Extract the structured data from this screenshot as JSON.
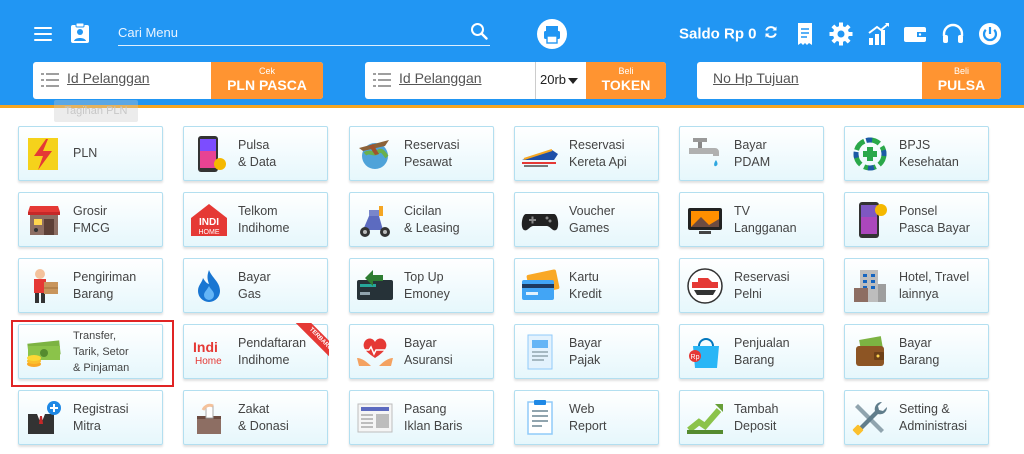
{
  "header": {
    "search_placeholder": "Cari Menu",
    "saldo_label": "Saldo Rp 0",
    "icons": [
      "menu-icon",
      "clipboard-icon",
      "search-icon",
      "print-icon",
      "refresh-icon",
      "receipt-icon",
      "gear-icon",
      "chart-icon",
      "wallet-icon",
      "headset-icon",
      "power-icon"
    ]
  },
  "payment": {
    "pln": {
      "placeholder": "Id Pelanggan",
      "btn_top": "Cek",
      "btn_bottom": "PLN PASCA"
    },
    "token": {
      "placeholder": "Id Pelanggan",
      "nominal": "20rb",
      "btn_top": "Beli",
      "btn_bottom": "TOKEN"
    },
    "pulsa": {
      "placeholder": "No Hp Tujuan",
      "btn_top": "Beli",
      "btn_bottom": "PULSA"
    }
  },
  "tooltip": "Tagihan PLN",
  "tiles": [
    [
      "PLN",
      "Pulsa\n& Data",
      "Reservasi\nPesawat",
      "Reservasi\nKereta Api",
      "Bayar\nPDAM",
      "BPJS\nKesehatan"
    ],
    [
      "Grosir\nFMCG",
      "Telkom\nIndihome",
      "Cicilan\n& Leasing",
      "Voucher\nGames",
      "TV\nLangganan",
      "Ponsel\nPasca Bayar"
    ],
    [
      "Pengiriman\nBarang",
      "Bayar\nGas",
      "Top Up\nEmoney",
      "Kartu\nKredit",
      "Reservasi\nPelni",
      "Hotel, Travel\nlainnya"
    ],
    [
      "Transfer,\nTarik, Setor\n& Pinjaman",
      "Pendaftaran\nIndihome",
      "Bayar\nAsuransi",
      "Bayar\nPajak",
      "Penjualan\nBarang",
      "Bayar\nBarang"
    ],
    [
      "Registrasi\nMitra",
      "Zakat\n& Donasi",
      "Pasang\nIklan Baris",
      "Web\nReport",
      "Tambah\nDeposit",
      "Setting &\nAdministrasi"
    ]
  ],
  "badges": {
    "new": "TERBARU",
    "indi_logo_top": "Indi",
    "indi_logo_bottom": "Home"
  },
  "colors": {
    "header": "#2196f3",
    "accent": "#ff9431",
    "tile_border": "#b3dff0",
    "highlight": "#e02424"
  }
}
